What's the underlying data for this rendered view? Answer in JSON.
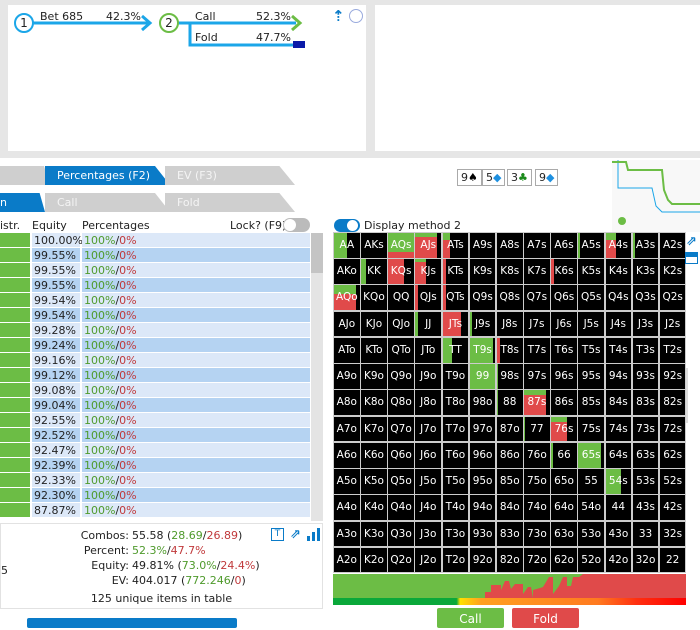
{
  "tree": {
    "node1": "1",
    "bet_label": "Bet 685",
    "bet_pct": "42.3%",
    "node2": "2",
    "call_label": "Call",
    "call_pct": "52.3%",
    "fold_label": "Fold",
    "fold_pct": "47.7%"
  },
  "tabs": {
    "row1": [
      "Percentages (F2)",
      "EV (F3)"
    ],
    "row2_first": "n",
    "row2": [
      "Call",
      "Fold"
    ]
  },
  "table": {
    "headers": {
      "distr": "istr.",
      "equity": "Equity",
      "percentages": "Percentages",
      "lock": "Lock? (F9)"
    },
    "rows": [
      {
        "equity": "100.00%",
        "call": "100%",
        "fold": "0%"
      },
      {
        "equity": "99.55%",
        "call": "100%",
        "fold": "0%"
      },
      {
        "equity": "99.55%",
        "call": "100%",
        "fold": "0%"
      },
      {
        "equity": "99.55%",
        "call": "100%",
        "fold": "0%"
      },
      {
        "equity": "99.54%",
        "call": "100%",
        "fold": "0%"
      },
      {
        "equity": "99.54%",
        "call": "100%",
        "fold": "0%"
      },
      {
        "equity": "99.28%",
        "call": "100%",
        "fold": "0%"
      },
      {
        "equity": "99.24%",
        "call": "100%",
        "fold": "0%"
      },
      {
        "equity": "99.16%",
        "call": "100%",
        "fold": "0%"
      },
      {
        "equity": "99.12%",
        "call": "100%",
        "fold": "0%"
      },
      {
        "equity": "99.08%",
        "call": "100%",
        "fold": "0%"
      },
      {
        "equity": "99.04%",
        "call": "100%",
        "fold": "0%"
      },
      {
        "equity": "92.55%",
        "call": "100%",
        "fold": "0%"
      },
      {
        "equity": "92.52%",
        "call": "100%",
        "fold": "0%"
      },
      {
        "equity": "92.47%",
        "call": "100%",
        "fold": "0%"
      },
      {
        "equity": "92.39%",
        "call": "100%",
        "fold": "0%"
      },
      {
        "equity": "92.33%",
        "call": "100%",
        "fold": "0%"
      },
      {
        "equity": "92.30%",
        "call": "100%",
        "fold": "0%"
      },
      {
        "equity": "87.87%",
        "call": "100%",
        "fold": "0%"
      }
    ]
  },
  "stats": {
    "combos_label": "Combos:",
    "combos": "55.58",
    "combos_call": "28.69",
    "combos_fold": "26.89",
    "percent_label": "Percent:",
    "pct_call": "52.3%",
    "pct_fold": "47.7%",
    "equity_label": "Equity:",
    "equity": "49.81%",
    "eq_call": "73.0%",
    "eq_fold": "24.4%",
    "ev_label": "EV:",
    "ev": "404.017",
    "ev_call": "772.246",
    "ev_fold": "0",
    "unique": "125 unique items in table",
    "cut_left": "5",
    "text_icon": "T"
  },
  "board": [
    {
      "rank": "9",
      "suit": "♠",
      "color": "#000000"
    },
    {
      "rank": "5",
      "suit": "◆",
      "color": "#1e90e0"
    },
    {
      "rank": "3",
      "suit": "♣",
      "color": "#1a8a1a"
    },
    {
      "rank": "9",
      "suit": "◆",
      "color": "#1e90e0"
    }
  ],
  "display_method": "Display method 2",
  "grid": {
    "labels": [
      [
        "AA",
        "AKs",
        "AQs",
        "AJs",
        "ATs",
        "A9s",
        "A8s",
        "A7s",
        "A6s",
        "A5s",
        "A4s",
        "A3s",
        "A2s"
      ],
      [
        "AKo",
        "KK",
        "KQs",
        "KJs",
        "KTs",
        "K9s",
        "K8s",
        "K7s",
        "K6s",
        "K5s",
        "K4s",
        "K3s",
        "K2s"
      ],
      [
        "AQo",
        "KQo",
        "QQ",
        "QJs",
        "QTs",
        "Q9s",
        "Q8s",
        "Q7s",
        "Q6s",
        "Q5s",
        "Q4s",
        "Q3s",
        "Q2s"
      ],
      [
        "AJo",
        "KJo",
        "QJo",
        "JJ",
        "JTs",
        "J9s",
        "J8s",
        "J7s",
        "J6s",
        "J5s",
        "J4s",
        "J3s",
        "J2s"
      ],
      [
        "ATo",
        "KTo",
        "QTo",
        "JTo",
        "TT",
        "T9s",
        "T8s",
        "T7s",
        "T6s",
        "T5s",
        "T4s",
        "T3s",
        "T2s"
      ],
      [
        "A9o",
        "K9o",
        "Q9o",
        "J9o",
        "T9o",
        "99",
        "98s",
        "97s",
        "96s",
        "95s",
        "94s",
        "93s",
        "92s"
      ],
      [
        "A8o",
        "K8o",
        "Q8o",
        "J8o",
        "T8o",
        "98o",
        "88",
        "87s",
        "86s",
        "85s",
        "84s",
        "83s",
        "82s"
      ],
      [
        "A7o",
        "K7o",
        "Q7o",
        "J7o",
        "T7o",
        "97o",
        "87o",
        "77",
        "76s",
        "75s",
        "74s",
        "73s",
        "72s"
      ],
      [
        "A6o",
        "K6o",
        "Q6o",
        "J6o",
        "T6o",
        "96o",
        "86o",
        "76o",
        "66",
        "65s",
        "64s",
        "63s",
        "62s"
      ],
      [
        "A5o",
        "K5o",
        "Q5o",
        "J5o",
        "T5o",
        "95o",
        "85o",
        "75o",
        "65o",
        "55",
        "54s",
        "53s",
        "52s"
      ],
      [
        "A4o",
        "K4o",
        "Q4o",
        "J4o",
        "T4o",
        "94o",
        "84o",
        "74o",
        "64o",
        "54o",
        "44",
        "43s",
        "42s"
      ],
      [
        "A3o",
        "K3o",
        "Q3o",
        "J3o",
        "T3o",
        "93o",
        "83o",
        "73o",
        "63o",
        "53o",
        "43o",
        "33",
        "32s"
      ],
      [
        "A2o",
        "K2o",
        "Q2o",
        "J2o",
        "T2o",
        "92o",
        "82o",
        "72o",
        "62o",
        "52o",
        "42o",
        "32o",
        "22"
      ]
    ],
    "frequencies": {
      "AA": [
        0.5,
        1
      ],
      "AQs": [
        1,
        0.75
      ],
      "AJs": [
        0.85,
        0.15
      ],
      "ATs": [
        0.3,
        0.3
      ],
      "A5s": [
        0.05,
        1
      ],
      "A4s": [
        0.4,
        0.3
      ],
      "A3s": [
        0.1,
        1
      ],
      "KK": [
        0.2,
        1
      ],
      "KQs": [
        0.6,
        0
      ],
      "KJs": [
        0.4,
        0.1
      ],
      "KTs": [
        0.15,
        0
      ],
      "K6s": [
        0.1,
        0
      ],
      "AQo": [
        0.85,
        0.35
      ],
      "QJs": [
        0.1,
        0
      ],
      "QTs": [
        0.15,
        0
      ],
      "JJ": [
        0.1,
        1
      ],
      "JTs": [
        0.7,
        0.03
      ],
      "J9s": [
        0.1,
        1
      ],
      "TT": [
        0.35,
        1
      ],
      "T9s": [
        0.9,
        1
      ],
      "T8s": [
        0.12,
        0
      ],
      "99": [
        1,
        1
      ],
      "98s": [
        0.05,
        1
      ],
      "88": [
        0.05,
        1
      ],
      "87s": [
        0.85,
        0.2
      ],
      "77": [
        0.05,
        1
      ],
      "76s": [
        0.6,
        0.2
      ],
      "66": [
        0.05,
        1
      ],
      "65s": [
        0.9,
        1
      ],
      "54s": [
        0.6,
        1
      ]
    }
  },
  "actions": {
    "call": "Call",
    "fold": "Fold"
  },
  "colors": {
    "call": "#6cbd45",
    "fold": "#e04a4a",
    "accent": "#0a7bc8",
    "cell_bg": "#000000"
  }
}
